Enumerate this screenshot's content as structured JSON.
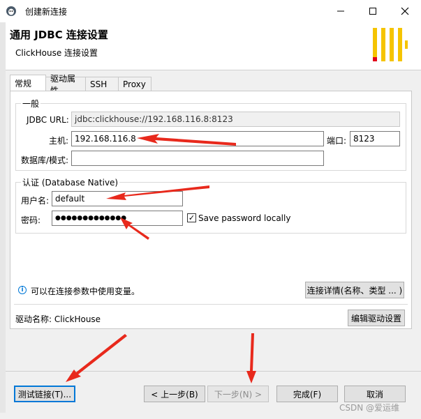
{
  "window": {
    "title": "创建新连接",
    "min_glyph": "—",
    "max_glyph": "☐",
    "close_glyph": "✕"
  },
  "header": {
    "title": "通用 JDBC 连接设置",
    "subtitle": "ClickHouse 连接设置"
  },
  "tabs": [
    {
      "label": "常规",
      "active": true
    },
    {
      "label": "驱动属性",
      "active": false
    },
    {
      "label": "SSH",
      "active": false
    },
    {
      "label": "Proxy",
      "active": false
    }
  ],
  "general": {
    "legend": "一般",
    "jdbc_url_label": "JDBC URL:",
    "jdbc_url_value": "jdbc:clickhouse://192.168.116.8:8123",
    "host_label": "主机:",
    "host_value": "192.168.116.8",
    "port_label": "端口:",
    "port_value": "8123",
    "database_label": "数据库/模式:",
    "database_value": ""
  },
  "auth": {
    "legend": "认证 (Database Native)",
    "username_label": "用户名:",
    "username_value": "default",
    "password_label": "密码:",
    "password_value": "●●●●●●●●●●●●●",
    "save_password_label": "Save password locally",
    "save_password_checked": true,
    "check_glyph": "✓"
  },
  "info": {
    "icon_glyph": "i",
    "text": "可以在连接参数中使用变量。",
    "details_button": "连接详情(名称、类型 ... )"
  },
  "driver": {
    "label": "驱动名称: ClickHouse",
    "edit_button": "编辑驱动设置"
  },
  "footer": {
    "test_button": "测试链接(T)...",
    "back_button": "< 上一步(B)",
    "next_button": "下一步(N) >",
    "finish_button": "完成(F)",
    "cancel_button": "取消"
  },
  "watermark": "CSDN @爱运维",
  "colors": {
    "accent": "#0078d7",
    "arrow": "#e8291c",
    "logo_yellow": "#f5c400",
    "logo_red": "#e2001a"
  }
}
